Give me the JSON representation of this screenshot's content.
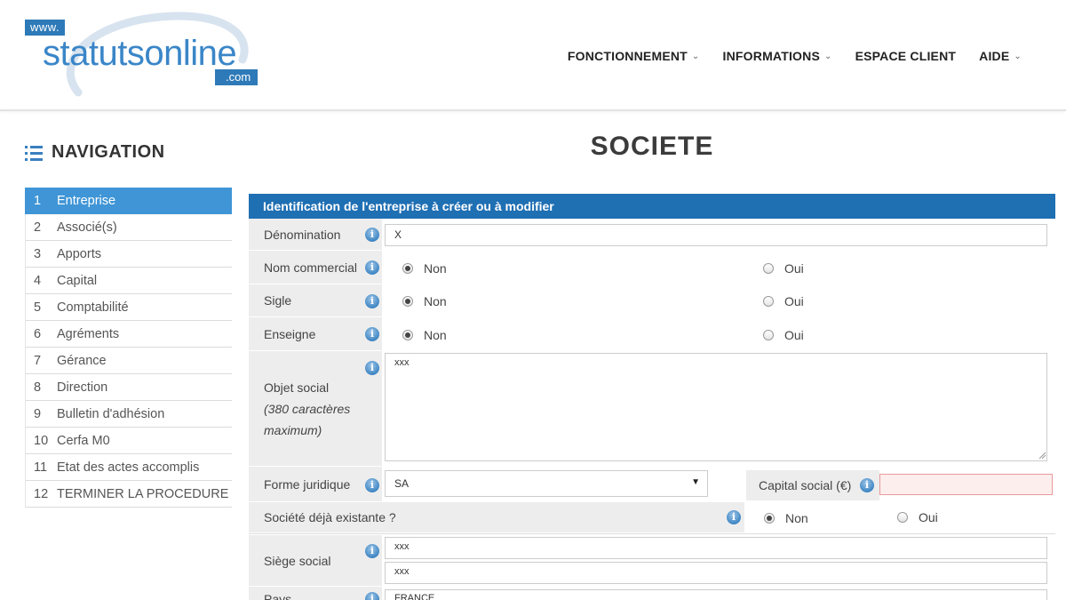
{
  "header": {
    "logo": {
      "www": "www.",
      "brand": "statutsonline",
      "com": ".com"
    },
    "nav": [
      {
        "label": "FONCTIONNEMENT",
        "has_menu": true
      },
      {
        "label": "INFORMATIONS",
        "has_menu": true
      },
      {
        "label": "ESPACE CLIENT",
        "has_menu": false
      },
      {
        "label": "AIDE",
        "has_menu": true
      }
    ]
  },
  "sidebar": {
    "title": "NAVIGATION",
    "items": [
      {
        "num": "1",
        "label": "Entreprise",
        "active": true
      },
      {
        "num": "2",
        "label": "Associé(s)"
      },
      {
        "num": "3",
        "label": "Apports"
      },
      {
        "num": "4",
        "label": "Capital"
      },
      {
        "num": "5",
        "label": "Comptabilité"
      },
      {
        "num": "6",
        "label": "Agréments"
      },
      {
        "num": "7",
        "label": "Gérance"
      },
      {
        "num": "8",
        "label": "Direction"
      },
      {
        "num": "9",
        "label": "Bulletin d'adhésion"
      },
      {
        "num": "10",
        "label": "Cerfa M0"
      },
      {
        "num": "11",
        "label": "Etat des actes accomplis"
      },
      {
        "num": "12",
        "label": "TERMINER LA PROCEDURE"
      }
    ]
  },
  "page_title": "SOCIETE",
  "form": {
    "section_title": "Identification de l'entreprise à créer ou à modifier",
    "denomination": {
      "label": "Dénomination",
      "value": "X"
    },
    "nom_commercial": {
      "label": "Nom commercial",
      "opt_no": "Non",
      "opt_yes": "Oui",
      "selected": "Non"
    },
    "sigle": {
      "label": "Sigle",
      "opt_no": "Non",
      "opt_yes": "Oui",
      "selected": "Non"
    },
    "enseigne": {
      "label": "Enseigne",
      "opt_no": "Non",
      "opt_yes": "Oui",
      "selected": "Non"
    },
    "objet_social": {
      "label": "Objet social",
      "hint": "(380 caractères maximum)",
      "value": "xxx"
    },
    "forme_juridique": {
      "label": "Forme juridique",
      "value": "SA"
    },
    "capital_social": {
      "label": "Capital social (€)",
      "value": ""
    },
    "societe_existante": {
      "label": "Société déjà existante ?",
      "opt_no": "Non",
      "opt_yes": "Oui",
      "selected": "Non"
    },
    "siege_social": {
      "label": "Siège social",
      "line1": "xxx",
      "line2": "xxx"
    },
    "pays": {
      "label": "Pays",
      "value": "FRANCE"
    }
  },
  "colors": {
    "accent": "#3f95d6",
    "section_header": "#1f6fb3",
    "label_bg": "#ededed",
    "error_border": "#e89a9a",
    "error_bg": "#fdeeee"
  },
  "icons": [
    "list-icon",
    "info-icon",
    "chevron-down-icon",
    "radio-icon"
  ]
}
